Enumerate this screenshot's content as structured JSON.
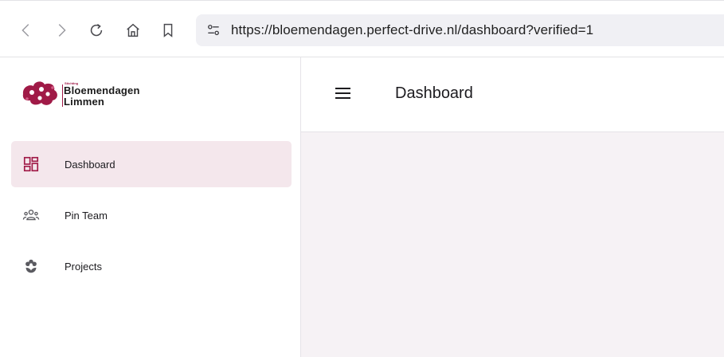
{
  "browser": {
    "url": "https://bloemendagen.perfect-drive.nl/dashboard?verified=1"
  },
  "brand": {
    "small": "Stichting",
    "line1": "Bloemendagen",
    "line2": "Limmen",
    "accent": "#a01a47"
  },
  "sidebar": {
    "items": [
      {
        "label": "Dashboard",
        "icon": "dashboard-icon",
        "active": true
      },
      {
        "label": "Pin Team",
        "icon": "team-icon",
        "active": false
      },
      {
        "label": "Projects",
        "icon": "flower-icon",
        "active": false
      }
    ]
  },
  "header": {
    "title": "Dashboard"
  },
  "colors": {
    "active_bg": "#f4e7ec",
    "content_bg": "#f6f2f5"
  }
}
